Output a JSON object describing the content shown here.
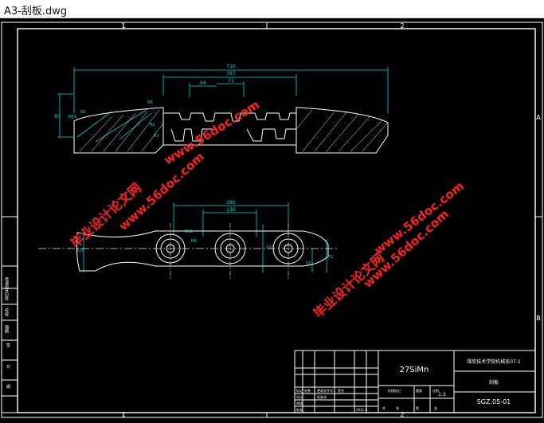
{
  "window": {
    "title": "A3-刮板.dwg"
  },
  "colors": {
    "background": "#000000",
    "border": "#ffffff",
    "dimension": "#00d8d8",
    "outline": "#ffffff",
    "watermark": "#ff2020",
    "centerline": "#e8e8e8"
  },
  "zones": {
    "top_1": "1",
    "top_2": "2",
    "right_a": "A",
    "right_b": "B",
    "bottom_1": "1",
    "bottom_2": "2"
  },
  "dims_top": {
    "overall": "710",
    "inner": "397",
    "d1": "68",
    "d2": "71",
    "left_h": "80",
    "left_a": "R52",
    "left_b": "R5",
    "left_c": "R8",
    "left_d": "R3",
    "left_e": "R3"
  },
  "dims_bottom": {
    "span": "280",
    "inner": "130",
    "left_h": "100",
    "center_h": "100",
    "right_h": "52",
    "right_w": "72",
    "hole_a": "R12",
    "hole_b": "R6"
  },
  "watermark": {
    "cn_1": "毕业设计论文网",
    "url_1": "www.56doc.com",
    "cn_2": "毕业设计论文网",
    "url_2": "www.56doc.com",
    "url_3": "www.56doc.com"
  },
  "left_strip": {
    "l1": "借通用件",
    "l2": "旧底",
    "l3": "校核",
    "l4": "描图",
    "l5": "签",
    "l6": "日",
    "l7": "期"
  },
  "title_block": {
    "material": "27SiMn",
    "school": "煤炭技术学院机械系07-1",
    "part_name": "刮板",
    "drawing_no": "SGZ.05-01",
    "scale_value": "1:3",
    "labels": {
      "l1": "标记",
      "l2": "处数",
      "l3": "更改文件号",
      "l4": "签名",
      "l5": "设计",
      "l6": "标准化",
      "l7": "阶段标记",
      "l8": "重量",
      "l9": "比例",
      "l10": "审核",
      "l11": "批准",
      "l12": "共",
      "l13": "张",
      "l14": "第",
      "l15": "张"
    },
    "date": "2011.6"
  }
}
